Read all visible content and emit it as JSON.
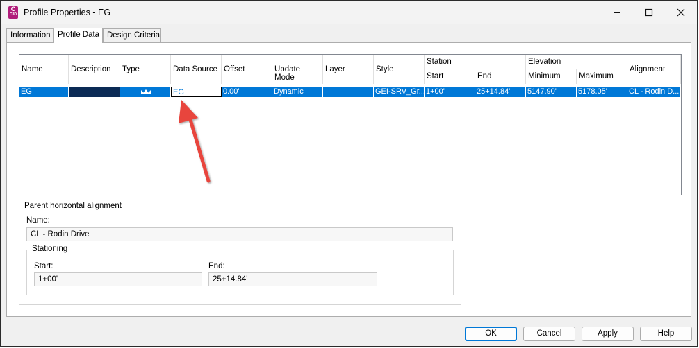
{
  "window": {
    "title": "Profile Properties - EG",
    "app_icon_letter": "C",
    "app_icon_sub": "C3D"
  },
  "tabs": [
    {
      "label": "Information"
    },
    {
      "label": "Profile Data"
    },
    {
      "label": "Design Criteria"
    }
  ],
  "grid": {
    "headers": {
      "name": "Name",
      "description": "Description",
      "type": "Type",
      "data_source": "Data Source",
      "offset": "Offset",
      "update_mode": "Update Mode",
      "layer": "Layer",
      "style": "Style",
      "station": "Station",
      "start": "Start",
      "end": "End",
      "elevation": "Elevation",
      "minimum": "Minimum",
      "maximum": "Maximum",
      "alignment": "Alignment"
    },
    "row": {
      "name": "EG",
      "description": "",
      "type_icon": "profile-type-icon",
      "data_source": "EG",
      "offset": "0.00'",
      "update_mode": "Dynamic",
      "layer": "",
      "style": "GEI-SRV_Gr...",
      "station_start": "1+00'",
      "station_end": "25+14.84'",
      "elev_min": "5147.90'",
      "elev_max": "5178.05'",
      "alignment": "CL - Rodin D..."
    }
  },
  "parent_alignment": {
    "legend": "Parent horizontal alignment",
    "name_label": "Name:",
    "name_value": "CL - Rodin Drive",
    "stationing_legend": "Stationing",
    "start_label": "Start:",
    "start_value": "1+00'",
    "end_label": "End:",
    "end_value": "25+14.84'"
  },
  "buttons": {
    "ok": "OK",
    "cancel": "Cancel",
    "apply": "Apply",
    "help": "Help"
  },
  "colors": {
    "selection": "#0078d7",
    "arrow": "#e8453c",
    "app_icon": "#b01c7a"
  }
}
